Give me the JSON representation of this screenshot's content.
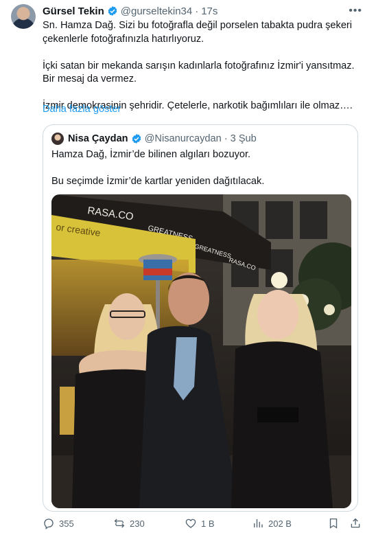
{
  "tweet": {
    "author_name": "Gürsel Tekin",
    "author_handle": "@gurseltekin34",
    "separator": "·",
    "time": "17s",
    "paragraphs": [
      "Sn. Hamza Dağ. Sizi bu fotoğrafla değil porselen tabakta pudra şekeri çekenlerle fotoğrafınızla hatırlıyoruz.",
      "İçki satan bir mekanda sarışın kadınlarla fotoğrafınız İzmir'i yansıtmaz. Bir mesaj da vermez.",
      "İzmir demokrasinin şehridir. Çetelerle, narkotik bağımlıları ile olmaz…."
    ],
    "show_more": "Daha fazla göster"
  },
  "quote": {
    "author_name": "Nisa Çaydan",
    "author_handle": "@Nisanurcaydan",
    "separator": "·",
    "time": "3 Şub",
    "paragraphs": [
      "Hamza Dağ, İzmir’de bilinen algıları bozuyor.",
      "Bu seçimde İzmir’de kartlar yeniden dağıtılacak."
    ],
    "photo_signs": [
      "RASA.CO",
      "GREATNESS",
      "GREATNESS",
      "RASA.CO",
      "or creative"
    ]
  },
  "actions": {
    "replies": "355",
    "retweets": "230",
    "likes": "1 B",
    "views": "202 B"
  },
  "colors": {
    "accent": "#1d9bf0",
    "secondary_text": "#536471",
    "border": "#cfd9de"
  },
  "icons": [
    "verified-badge-icon",
    "more-icon",
    "reply-icon",
    "retweet-icon",
    "like-icon",
    "views-icon",
    "bookmark-icon",
    "share-icon"
  ]
}
